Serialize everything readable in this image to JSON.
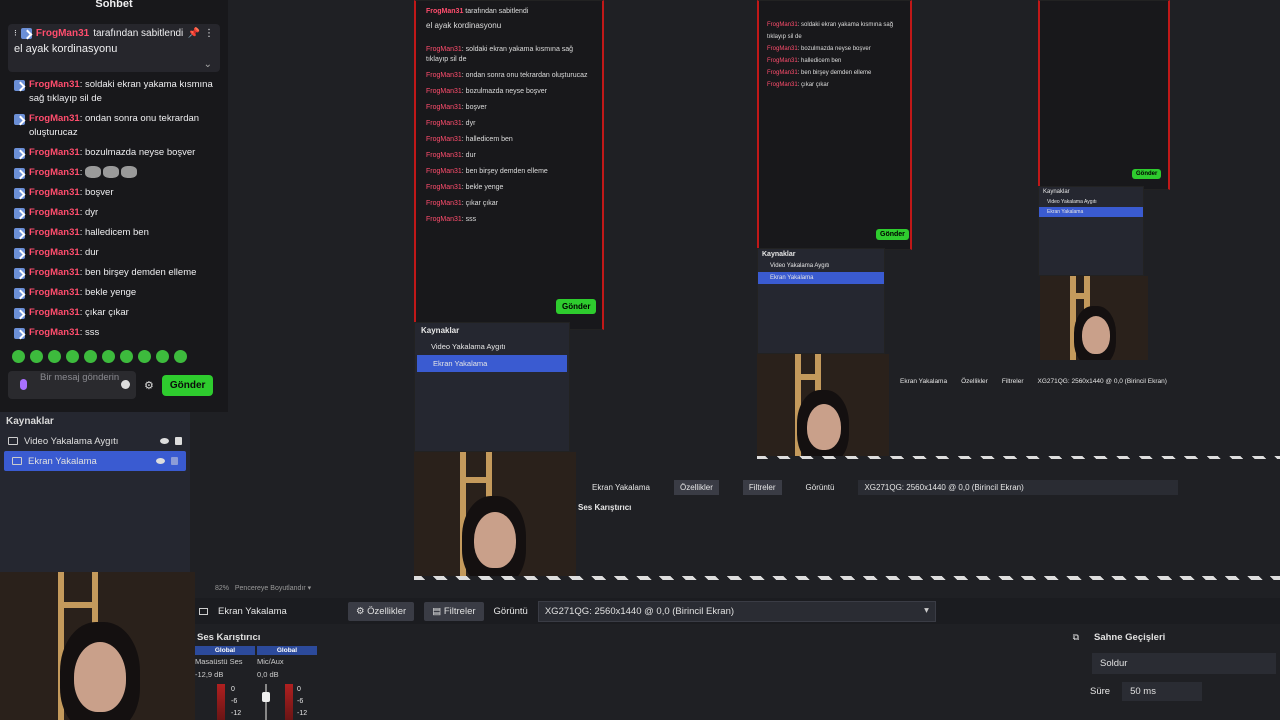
{
  "chat": {
    "title": "Sohbet",
    "pinned_by_user": "FrogMan31",
    "pinned_by_suffix": "tarafından sabitlendi",
    "pinned_message": "el ayak kordinasyonu",
    "messages": [
      {
        "user": "FrogMan31",
        "text": ": soldaki ekran yakama kısmına sağ tıklayıp sil de"
      },
      {
        "user": "FrogMan31",
        "text": ": ondan sonra onu tekrardan oluşturucaz"
      },
      {
        "user": "FrogMan31",
        "text": ": bozulmazda neyse boşver"
      },
      {
        "user": "FrogMan31",
        "text": ":"
      },
      {
        "user": "FrogMan31",
        "text": ": boşver"
      },
      {
        "user": "FrogMan31",
        "text": ": dyr"
      },
      {
        "user": "FrogMan31",
        "text": ": halledicem ben"
      },
      {
        "user": "FrogMan31",
        "text": ": dur"
      },
      {
        "user": "FrogMan31",
        "text": ": ben birşey demden elleme"
      },
      {
        "user": "FrogMan31",
        "text": ": bekle yenge"
      },
      {
        "user": "FrogMan31",
        "text": ": çıkar çıkar"
      },
      {
        "user": "FrogMan31",
        "text": ": sss"
      }
    ],
    "input_placeholder": "Bir mesaj gönderin",
    "send_label": "Gönder"
  },
  "sources": {
    "title": "Kaynaklar",
    "items": [
      {
        "label": "Video Yakalama Aygıtı"
      },
      {
        "label": "Ekran Yakalama"
      }
    ]
  },
  "toolbar": {
    "zoom": "82%",
    "scale_mode": "Pencereye Boyutlandır",
    "source_name": "Ekran Yakalama",
    "properties_label": "Özellikler",
    "filters_label": "Filtreler",
    "display_label": "Görüntü",
    "display_value": "XG271QG: 2560x1440 @ 0,0 (Birincil Ekran)"
  },
  "mixer": {
    "title": "Ses Karıştırıcı",
    "channels": [
      {
        "global": "Global",
        "name": "Masaüstü Ses",
        "db": "-12,9 dB"
      },
      {
        "global": "Global",
        "name": "Mic/Aux",
        "db": "0,0 dB"
      }
    ],
    "scale": [
      "0",
      "-6",
      "-12"
    ]
  },
  "transitions": {
    "title": "Sahne Geçişleri",
    "type": "Soldur",
    "duration_label": "Süre",
    "duration_value": "50 ms"
  },
  "colors": {
    "username": "#ff4d6d",
    "send_button": "#2ecc2e",
    "selected_source": "#3a5bd1",
    "preview_border": "#c01818"
  }
}
